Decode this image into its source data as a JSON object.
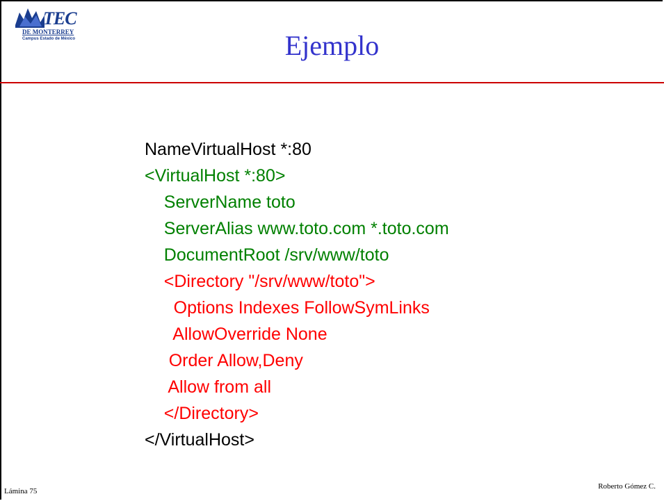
{
  "logo": {
    "main": "TEC",
    "line1": "DE MONTERREY",
    "line2": "Campus Estado de México"
  },
  "slide": {
    "title": "Ejemplo"
  },
  "code_lines": [
    {
      "text": "NameVirtualHost *:80",
      "color": "black",
      "indent": ""
    },
    {
      "text": "<VirtualHost *:80>",
      "color": "green",
      "indent": ""
    },
    {
      "text": "ServerName toto",
      "color": "green",
      "indent": "    "
    },
    {
      "text": "ServerAlias www.toto.com *.toto.com",
      "color": "green",
      "indent": "    "
    },
    {
      "text": "DocumentRoot /srv/www/toto",
      "color": "green",
      "indent": "    "
    },
    {
      "text": "<Directory \"/srv/www/toto\">",
      "color": "red",
      "indent": "    "
    },
    {
      "text": "Options Indexes FollowSymLinks",
      "color": "red",
      "indent": "      "
    },
    {
      "text": "AllowOverride None",
      "color": "red",
      "indent": "      "
    },
    {
      "text": "Order Allow,Deny",
      "color": "red",
      "indent": "     "
    },
    {
      "text": "Allow from all",
      "color": "red",
      "indent": "     "
    },
    {
      "text": "</Directory>",
      "color": "red",
      "indent": "    "
    },
    {
      "text": "</VirtualHost>",
      "color": "black",
      "indent": ""
    }
  ],
  "footer": {
    "slide_number": "Lámina 75",
    "author": "Roberto Gómez C."
  }
}
